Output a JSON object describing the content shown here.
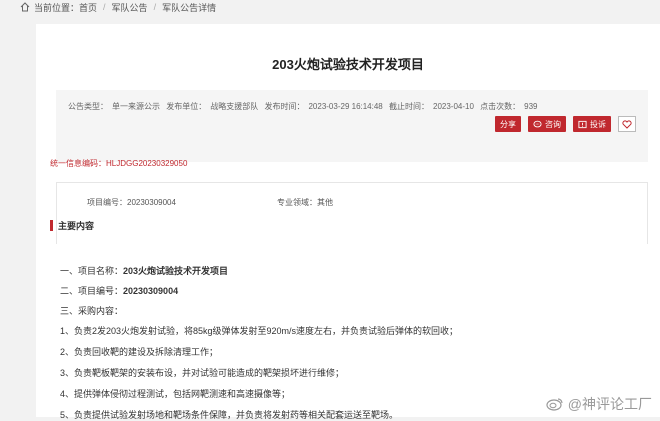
{
  "breadcrumb": {
    "prefix": "当前位置：",
    "items": [
      "首页",
      "军队公告",
      "军队公告详情"
    ],
    "separator": "/"
  },
  "notice": {
    "title": "203火炮试验技术开发项目",
    "meta": {
      "type_label": "公告类型：",
      "type_value": "单一来源公示",
      "unit_label": "发布单位：",
      "unit_value": "战略支援部队",
      "publish_label": "发布时间：",
      "publish_value": "2023-03-29 16:14:48",
      "deadline_label": "截止时间：",
      "deadline_value": "2023-04-10",
      "clicks_label": "点击次数：",
      "clicks_value": "939"
    },
    "actions": {
      "share": "分享",
      "consult": "咨询",
      "complaint": "投诉"
    },
    "unified_code_label": "统一信息编码：",
    "unified_code_value": "HLJDGG20230329050",
    "project_no_label": "项目编号：",
    "project_no_value": "20230309004",
    "field_label": "专业领域：",
    "field_value": "其他",
    "section_title": "主要内容"
  },
  "content": {
    "item1_prefix": "一、项目名称：",
    "item1_value": "203火炮试验技术开发项目",
    "item2_prefix": "二、项目编号：",
    "item2_value": "20230309004",
    "item3": "三、采购内容：",
    "line1": "1、负责2发203火炮发射试验，将85kg级弹体发射至920m/s速度左右，并负责试验后弹体的软回收；",
    "line2": "2、负责回收靶的建设及拆除清理工作；",
    "line3": "3、负责靶板靶架的安装布设，并对试验可能造成的靶架损坏进行维修；",
    "line4": "4、提供弹体侵彻过程测试，包括网靶测速和高速摄像等；",
    "line5": "5、负责提供试验发射场地和靶场条件保障，并负责将发射药等相关配套运送至靶场。"
  },
  "watermark": {
    "text": "@神评论工厂"
  },
  "colors": {
    "accent": "#c0282e",
    "background": "#f2f2f2",
    "card": "#ffffff"
  }
}
